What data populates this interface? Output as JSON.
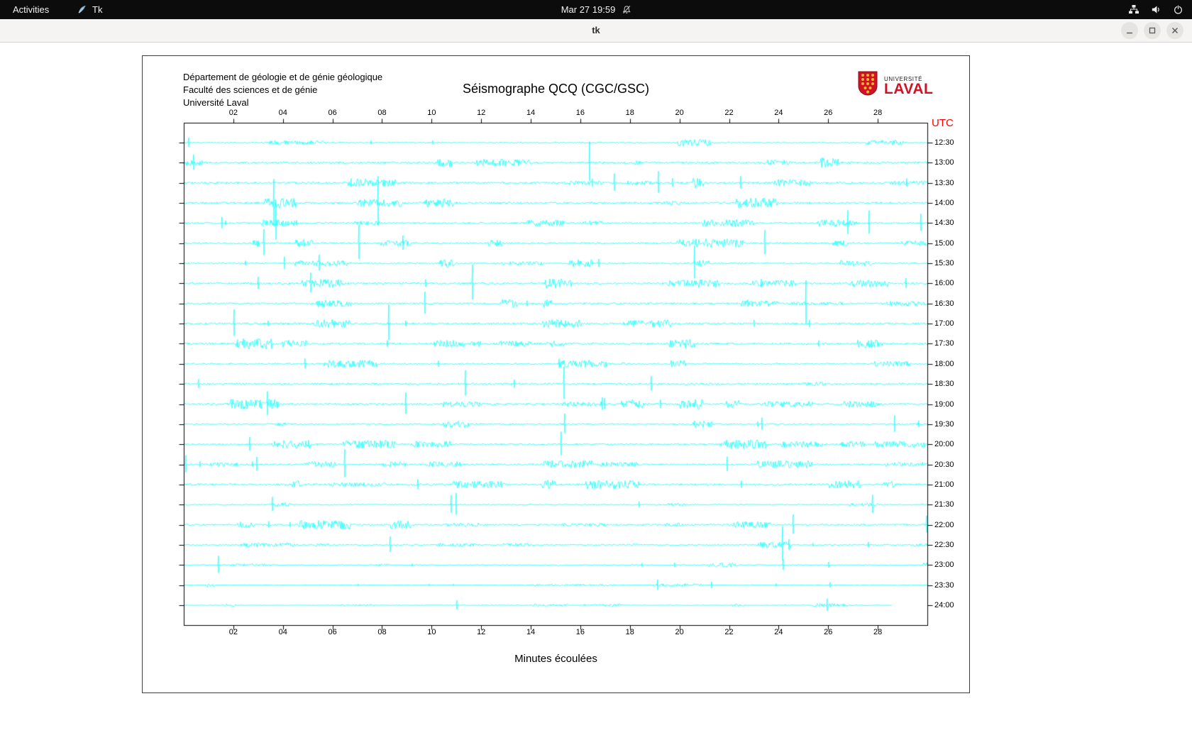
{
  "top_bar": {
    "activities_label": "Activities",
    "app_menu_label": "Tk",
    "clock": "Mar 27 19:59"
  },
  "window": {
    "title": "tk"
  },
  "seismograph": {
    "header_lines": [
      "Département de géologie et de génie géologique",
      "Faculté des sciences et de génie",
      "Université Laval"
    ],
    "title": "Séismographe QCQ (CGC/GSC)",
    "logo": {
      "line1": "UNIVERSITÉ",
      "line2": "LAVAL"
    },
    "utc_label": "UTC",
    "xlabel": "Minutes écoulées",
    "x_ticks": [
      "02",
      "04",
      "06",
      "08",
      "10",
      "12",
      "14",
      "16",
      "18",
      "20",
      "22",
      "24",
      "26",
      "28"
    ],
    "time_labels": [
      "12:30",
      "13:00",
      "13:30",
      "14:00",
      "14:30",
      "15:00",
      "15:30",
      "16:00",
      "16:30",
      "17:00",
      "17:30",
      "18:00",
      "18:30",
      "19:00",
      "19:30",
      "20:00",
      "20:30",
      "21:00",
      "21:30",
      "22:00",
      "22:30",
      "23:00",
      "23:30",
      "24:00"
    ],
    "x_minutes_range": [
      0,
      30
    ],
    "trace_color": "#00ffff",
    "axis_color": "#000000",
    "utc_color": "#ff0000",
    "laval_red": "#d11224",
    "laval_gold": "#f0b72f"
  }
}
